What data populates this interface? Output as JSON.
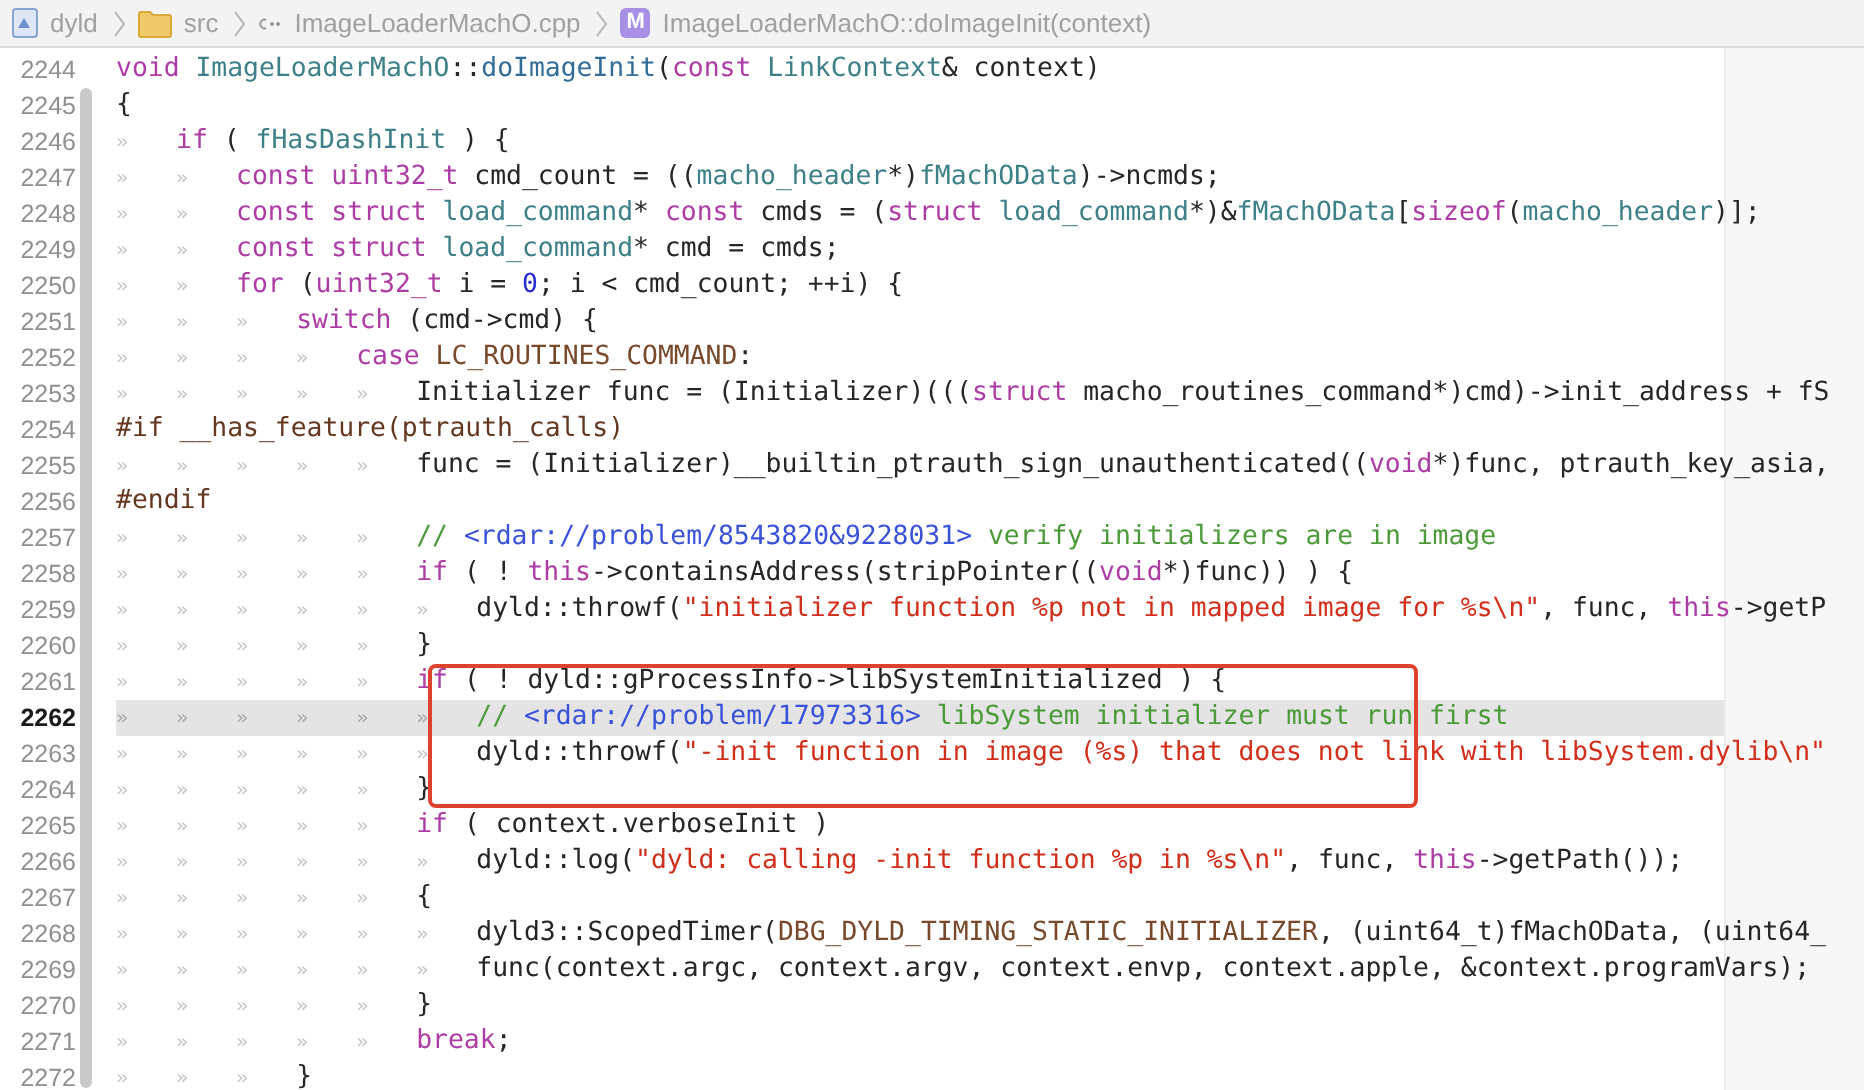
{
  "breadcrumb": [
    {
      "kind": "project",
      "label": "dyld"
    },
    {
      "kind": "folder",
      "label": "src"
    },
    {
      "kind": "file",
      "label": "ImageLoaderMachO.cpp"
    },
    {
      "kind": "method",
      "badge": "M",
      "label": "ImageLoaderMachO::doImageInit(context)"
    }
  ],
  "lines": [
    {
      "number": "2244",
      "current": false,
      "boxed": false,
      "tokens": [
        {
          "kind": "kw",
          "text": "void"
        },
        {
          "kind": "type",
          "text": " ImageLoaderMachO"
        },
        {
          "kind": "txt",
          "text": "::"
        },
        {
          "kind": "fn",
          "text": "doImageInit"
        },
        {
          "kind": "txt",
          "text": "("
        },
        {
          "kind": "kw",
          "text": "const"
        },
        {
          "kind": "type",
          "text": " LinkContext"
        },
        {
          "kind": "txt",
          "text": "& context)"
        }
      ]
    },
    {
      "number": "2245",
      "current": false,
      "boxed": false,
      "tokens": [
        {
          "kind": "txt",
          "text": "{"
        }
      ]
    },
    {
      "number": "2246",
      "current": false,
      "boxed": false,
      "indent": "»",
      "tokens": [
        {
          "kind": "kw",
          "text": "if"
        },
        {
          "kind": "txt",
          "text": " ( "
        },
        {
          "kind": "type",
          "text": "fHasDashInit"
        },
        {
          "kind": "txt",
          "text": " ) {"
        }
      ]
    },
    {
      "number": "2247",
      "current": false,
      "boxed": false,
      "indent": "»»",
      "tokens": [
        {
          "kind": "kw",
          "text": "const uint32_t"
        },
        {
          "kind": "txt",
          "text": " cmd_count = (("
        },
        {
          "kind": "type",
          "text": "macho_header"
        },
        {
          "kind": "txt",
          "text": "*)"
        },
        {
          "kind": "type",
          "text": "fMachOData"
        },
        {
          "kind": "txt",
          "text": ")->ncmds;"
        }
      ]
    },
    {
      "number": "2248",
      "current": false,
      "boxed": false,
      "indent": "»»",
      "tokens": [
        {
          "kind": "kw",
          "text": "const struct"
        },
        {
          "kind": "type",
          "text": " load_command"
        },
        {
          "kind": "txt",
          "text": "* "
        },
        {
          "kind": "kw",
          "text": "const"
        },
        {
          "kind": "txt",
          "text": " cmds = ("
        },
        {
          "kind": "kw",
          "text": "struct"
        },
        {
          "kind": "type",
          "text": " load_command"
        },
        {
          "kind": "txt",
          "text": "*)&"
        },
        {
          "kind": "type",
          "text": "fMachOData"
        },
        {
          "kind": "txt",
          "text": "["
        },
        {
          "kind": "kw",
          "text": "sizeof"
        },
        {
          "kind": "txt",
          "text": "("
        },
        {
          "kind": "type",
          "text": "macho_header"
        },
        {
          "kind": "txt",
          "text": ")];"
        }
      ]
    },
    {
      "number": "2249",
      "current": false,
      "boxed": false,
      "indent": "»»",
      "tokens": [
        {
          "kind": "kw",
          "text": "const struct"
        },
        {
          "kind": "type",
          "text": " load_command"
        },
        {
          "kind": "txt",
          "text": "* cmd = cmds;"
        }
      ]
    },
    {
      "number": "2250",
      "current": false,
      "boxed": false,
      "indent": "»»",
      "tokens": [
        {
          "kind": "kw",
          "text": "for"
        },
        {
          "kind": "txt",
          "text": " ("
        },
        {
          "kind": "kw",
          "text": "uint32_t"
        },
        {
          "kind": "txt",
          "text": " i = "
        },
        {
          "kind": "num",
          "text": "0"
        },
        {
          "kind": "txt",
          "text": "; i < cmd_count; ++i) {"
        }
      ]
    },
    {
      "number": "2251",
      "current": false,
      "boxed": false,
      "indent": "»»»",
      "tokens": [
        {
          "kind": "kw",
          "text": "switch"
        },
        {
          "kind": "txt",
          "text": " (cmd->cmd) {"
        }
      ]
    },
    {
      "number": "2252",
      "current": false,
      "boxed": false,
      "indent": "»»»»",
      "tokens": [
        {
          "kind": "kw",
          "text": "case"
        },
        {
          "kind": "mac",
          "text": " LC_ROUTINES_COMMAND"
        },
        {
          "kind": "txt",
          "text": ":"
        }
      ]
    },
    {
      "number": "2253",
      "current": false,
      "boxed": false,
      "indent": "»»»»»",
      "tokens": [
        {
          "kind": "txt",
          "text": "Initializer func = (Initializer)((("
        },
        {
          "kind": "kw",
          "text": "struct"
        },
        {
          "kind": "txt",
          "text": " macho_routines_command*)cmd)->init_address + fS"
        }
      ]
    },
    {
      "number": "2254",
      "current": false,
      "boxed": false,
      "tokens": [
        {
          "kind": "pre",
          "text": "#if __has_feature(ptrauth_calls)"
        }
      ]
    },
    {
      "number": "2255",
      "current": false,
      "boxed": false,
      "indent": "»»»»»",
      "tokens": [
        {
          "kind": "txt",
          "text": "func = (Initializer)__builtin_ptrauth_sign_unauthenticated(("
        },
        {
          "kind": "kw",
          "text": "void"
        },
        {
          "kind": "txt",
          "text": "*)func, ptrauth_key_asia,"
        }
      ]
    },
    {
      "number": "2256",
      "current": false,
      "boxed": false,
      "tokens": [
        {
          "kind": "pre",
          "text": "#endif"
        }
      ]
    },
    {
      "number": "2257",
      "current": false,
      "boxed": false,
      "indent": "»»»»»",
      "tokens": [
        {
          "kind": "com",
          "text": "// "
        },
        {
          "kind": "url",
          "text": "<rdar://problem/8543820&9228031>"
        },
        {
          "kind": "com",
          "text": " verify initializers are in image"
        }
      ]
    },
    {
      "number": "2258",
      "current": false,
      "boxed": false,
      "indent": "»»»»»",
      "tokens": [
        {
          "kind": "kw",
          "text": "if"
        },
        {
          "kind": "txt",
          "text": " ( ! "
        },
        {
          "kind": "kw",
          "text": "this"
        },
        {
          "kind": "txt",
          "text": "->containsAddress(stripPointer(("
        },
        {
          "kind": "kw",
          "text": "void"
        },
        {
          "kind": "txt",
          "text": "*)func)) ) {"
        }
      ]
    },
    {
      "number": "2259",
      "current": false,
      "boxed": false,
      "indent": "»»»»»»",
      "tokens": [
        {
          "kind": "txt",
          "text": "dyld::throwf("
        },
        {
          "kind": "str",
          "text": "\"initializer function %p not in mapped image for %s\\n\""
        },
        {
          "kind": "txt",
          "text": ", func, "
        },
        {
          "kind": "kw",
          "text": "this"
        },
        {
          "kind": "txt",
          "text": "->getP"
        }
      ]
    },
    {
      "number": "2260",
      "current": false,
      "boxed": false,
      "indent": "»»»»»",
      "tokens": [
        {
          "kind": "txt",
          "text": "}"
        }
      ]
    },
    {
      "number": "2261",
      "current": false,
      "boxed": true,
      "indent": "»»»»»",
      "tokens": [
        {
          "kind": "kw",
          "text": "if"
        },
        {
          "kind": "txt",
          "text": " ( ! dyld::gProcessInfo->libSystemInitialized ) {"
        }
      ]
    },
    {
      "number": "2262",
      "current": true,
      "boxed": true,
      "indent": "»»»»»»",
      "tokens": [
        {
          "kind": "com",
          "text": "// "
        },
        {
          "kind": "url",
          "text": "<rdar://problem/17973316>"
        },
        {
          "kind": "com",
          "text": " libSystem initializer must run first"
        }
      ]
    },
    {
      "number": "2263",
      "current": false,
      "boxed": true,
      "indent": "»»»»»»",
      "tokens": [
        {
          "kind": "txt",
          "text": "dyld::throwf("
        },
        {
          "kind": "str",
          "text": "\"-init function in image (%s) that does not link with libSystem.dylib\\n\""
        }
      ]
    },
    {
      "number": "2264",
      "current": false,
      "boxed": true,
      "indent": "»»»»»",
      "tokens": [
        {
          "kind": "txt",
          "text": "}"
        }
      ]
    },
    {
      "number": "2265",
      "current": false,
      "boxed": false,
      "indent": "»»»»»",
      "tokens": [
        {
          "kind": "kw",
          "text": "if"
        },
        {
          "kind": "txt",
          "text": " ( context.verboseInit )"
        }
      ]
    },
    {
      "number": "2266",
      "current": false,
      "boxed": false,
      "indent": "»»»»»»",
      "tokens": [
        {
          "kind": "txt",
          "text": "dyld::log("
        },
        {
          "kind": "str",
          "text": "\"dyld: calling -init function %p in %s\\n\""
        },
        {
          "kind": "txt",
          "text": ", func, "
        },
        {
          "kind": "kw",
          "text": "this"
        },
        {
          "kind": "txt",
          "text": "->getPath());"
        }
      ]
    },
    {
      "number": "2267",
      "current": false,
      "boxed": false,
      "indent": "»»»»»",
      "tokens": [
        {
          "kind": "txt",
          "text": "{"
        }
      ]
    },
    {
      "number": "2268",
      "current": false,
      "boxed": false,
      "indent": "»»»»»»",
      "tokens": [
        {
          "kind": "txt",
          "text": "dyld3::ScopedTimer("
        },
        {
          "kind": "mac",
          "text": "DBG_DYLD_TIMING_STATIC_INITIALIZER"
        },
        {
          "kind": "txt",
          "text": ", (uint64_t)fMachOData, (uint64_"
        }
      ]
    },
    {
      "number": "2269",
      "current": false,
      "boxed": false,
      "indent": "»»»»»»",
      "tokens": [
        {
          "kind": "txt",
          "text": "func(context.argc, context.argv, context.envp, context.apple, &context.programVars);"
        }
      ]
    },
    {
      "number": "2270",
      "current": false,
      "boxed": false,
      "indent": "»»»»»",
      "tokens": [
        {
          "kind": "txt",
          "text": "}"
        }
      ]
    },
    {
      "number": "2271",
      "current": false,
      "boxed": false,
      "indent": "»»»»»",
      "tokens": [
        {
          "kind": "kw",
          "text": "break"
        },
        {
          "kind": "txt",
          "text": ";"
        }
      ]
    },
    {
      "number": "2272",
      "current": false,
      "boxed": false,
      "indent": "»»»",
      "tokens": [
        {
          "kind": "txt",
          "text": "}"
        }
      ]
    }
  ]
}
